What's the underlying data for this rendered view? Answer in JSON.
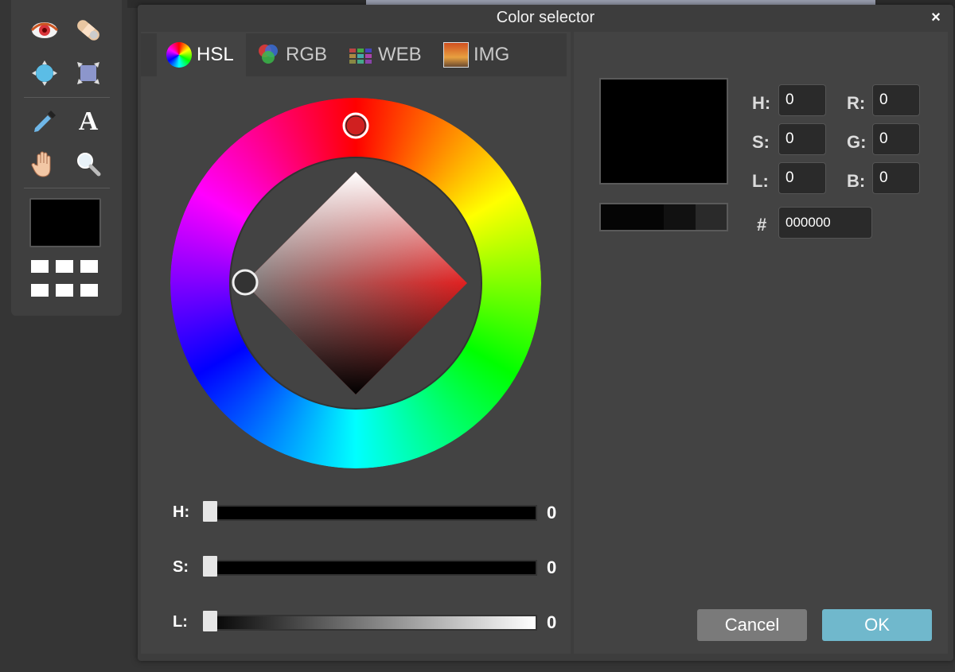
{
  "toolbar": {
    "tools": [
      {
        "name": "red-eye-icon"
      },
      {
        "name": "bandage-icon"
      },
      {
        "name": "blur-icon"
      },
      {
        "name": "sponge-icon"
      },
      {
        "name": "eyedropper-icon"
      },
      {
        "name": "text-icon",
        "glyph": "A"
      },
      {
        "name": "hand-icon"
      },
      {
        "name": "zoom-icon"
      }
    ],
    "primary_color": "#000000"
  },
  "dialog": {
    "title": "Color selector",
    "close_glyph": "×",
    "tabs": [
      {
        "label": "HSL",
        "active": true
      },
      {
        "label": "RGB",
        "active": false
      },
      {
        "label": "WEB",
        "active": false
      },
      {
        "label": "IMG",
        "active": false
      }
    ],
    "sliders": [
      {
        "label": "H:",
        "value": "0"
      },
      {
        "label": "S:",
        "value": "0"
      },
      {
        "label": "L:",
        "value": "0"
      }
    ],
    "fields": {
      "h_label": "H:",
      "h_value": "0",
      "s_label": "S:",
      "s_value": "0",
      "l_label": "L:",
      "l_value": "0",
      "r_label": "R:",
      "r_value": "0",
      "g_label": "G:",
      "g_value": "0",
      "b_label": "B:",
      "b_value": "0",
      "hex_label": "#",
      "hex_value": "000000"
    },
    "preview_color": "#000000",
    "recent_colors": [
      "#050505",
      "#111111",
      "#2a2a2a"
    ],
    "buttons": {
      "cancel": "Cancel",
      "ok": "OK"
    },
    "accent_color": "#70b8cc"
  }
}
